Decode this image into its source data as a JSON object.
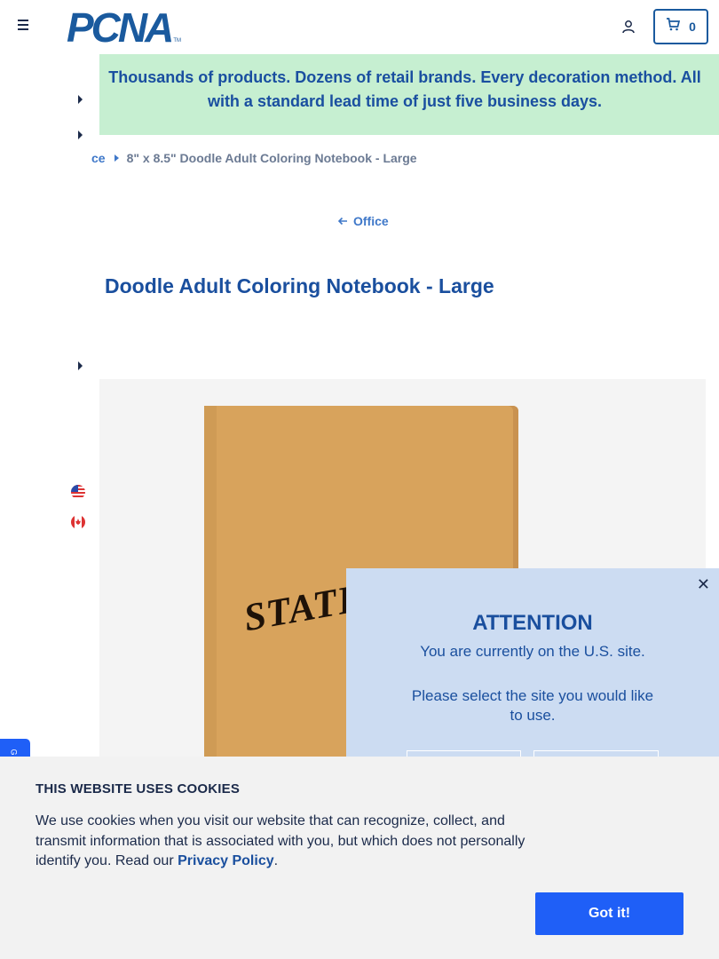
{
  "header": {
    "logo_text": "PCNA",
    "logo_tm": "TM",
    "cart_count": "0"
  },
  "banner": {
    "line1": "Thousands of products. Dozens of retail brands. Every decoration method. All",
    "line2": "with a standard lead time of just five business days."
  },
  "breadcrumb": {
    "parent": "ce",
    "current": "8\" x 8.5\" Doodle Adult Coloring Notebook - Large"
  },
  "back_link": {
    "label": "Office"
  },
  "product": {
    "title": "Doodle Adult Coloring Notebook - Large",
    "imprint_text": "STATIO"
  },
  "attention": {
    "title": "ATTENTION",
    "message1": "You are currently on the U.S. site.",
    "message2": "Please select the site you would like to use."
  },
  "cookie": {
    "title": "THIS WEBSITE USES COOKIES",
    "text_before": "We use cookies when you visit our website that can recognize, collect, and transmit information that is associated with you, but which does not personally identify you. Read our ",
    "link": "Privacy Policy",
    "text_after": ".",
    "button": "Got it!"
  },
  "side_tab": {
    "label": "G"
  },
  "colors": {
    "brand_blue": "#1a5a9e",
    "banner_bg": "#c6efd1",
    "modal_bg": "#ccdcf2",
    "cta_blue": "#1f5ff7"
  }
}
